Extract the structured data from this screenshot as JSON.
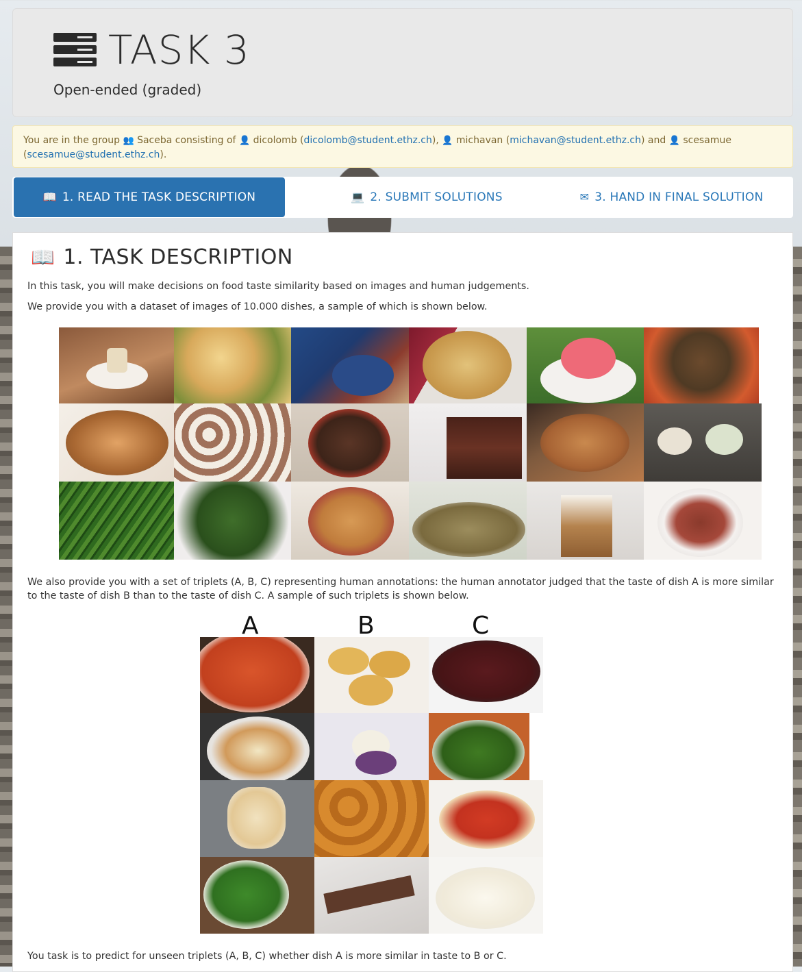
{
  "header": {
    "title": "TASK 3",
    "subtitle": "Open-ended (graded)",
    "logo_icon": "server-stack-icon"
  },
  "group_alert": {
    "prefix": "You are in the group",
    "group_name": "Saceba",
    "consisting_of": "consisting of",
    "members": [
      {
        "user": "dicolomb",
        "email": "dicolomb@student.ethz.ch"
      },
      {
        "user": "michavan",
        "email": "michavan@student.ethz.ch"
      },
      {
        "user": "scesamue",
        "email": "scesamue@student.ethz.ch"
      }
    ],
    "and_word": "and"
  },
  "tabs": [
    {
      "label": "1. READ THE TASK DESCRIPTION",
      "icon": "book-icon",
      "active": true
    },
    {
      "label": "2. SUBMIT SOLUTIONS",
      "icon": "laptop-icon",
      "active": false
    },
    {
      "label": "3. HAND IN FINAL SOLUTION",
      "icon": "envelope-icon",
      "active": false
    }
  ],
  "section": {
    "title": "1. TASK DESCRIPTION",
    "icon": "book-icon",
    "paragraph1": "In this task, you will make decisions on food taste similarity based on images and human judgements.",
    "paragraph2": "We provide you with a dataset of images of 10.000 dishes, a sample of which is shown below.",
    "paragraph3": "We also provide you with a set of triplets (A, B, C) representing human annotations: the human annotator judged that the taste of dish A is more similar to the taste of dish B than to the taste of dish C. A sample of such triplets is shown below.",
    "paragraph4": "You task is to predict for unseen triplets (A, B, C) whether dish A is more similar in taste to B or C."
  },
  "triplet_labels": [
    "A",
    "B",
    "C"
  ],
  "colors": {
    "active_tab": "#2a72b0",
    "link": "#1f6fb0",
    "alert_bg": "#fcf8e3",
    "alert_text": "#7b6630"
  }
}
